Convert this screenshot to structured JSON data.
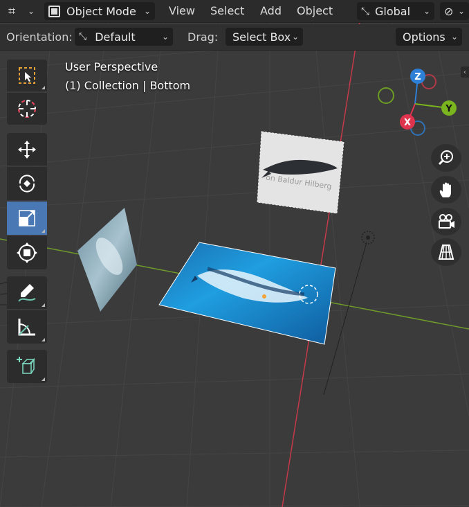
{
  "header": {
    "editor_type_icon": "viewport-grid-icon",
    "mode_dropdown": {
      "label": "Object Mode",
      "icon": "object-mode-icon"
    },
    "menus": [
      "View",
      "Select",
      "Add",
      "Object"
    ],
    "transform_orientation": {
      "label": "Global",
      "icon": "transform-orientation-icon"
    },
    "snap_icon": "link-icon"
  },
  "tool_settings": {
    "orientation_label": "Orientation:",
    "orientation_value": "Default",
    "drag_label": "Drag:",
    "drag_value": "Select Box",
    "options_label": "Options"
  },
  "overlay": {
    "perspective": "User Perspective",
    "collection": "(1) Collection | Bottom"
  },
  "toolbar": {
    "tools": [
      {
        "name": "select-box",
        "icon": "select-box-icon",
        "active": false
      },
      {
        "name": "cursor",
        "icon": "cursor-icon",
        "active": false
      },
      {
        "name": "move",
        "icon": "move-icon",
        "active": false
      },
      {
        "name": "rotate",
        "icon": "rotate-icon",
        "active": false
      },
      {
        "name": "scale",
        "icon": "scale-icon",
        "active": true
      },
      {
        "name": "transform",
        "icon": "transform-icon",
        "active": false
      },
      {
        "name": "annotate",
        "icon": "annotate-icon",
        "active": false
      },
      {
        "name": "measure",
        "icon": "measure-icon",
        "active": false
      },
      {
        "name": "add-cube",
        "icon": "add-cube-icon",
        "active": false
      }
    ]
  },
  "gizmo": {
    "x_label": "X",
    "y_label": "Y",
    "z_label": "Z"
  },
  "nav_buttons": [
    "zoom-icon",
    "hand-pan-icon",
    "camera-icon",
    "grid-perspective-icon"
  ],
  "scene": {
    "image_plane_top_caption": "on Baldur Hilberg"
  },
  "colors": {
    "x_axis": "#e0344e",
    "y_axis": "#7ab51f",
    "z_axis": "#2e7fd6",
    "active_tool": "#4a78b4",
    "viewport_bg": "#3a3a3a"
  }
}
